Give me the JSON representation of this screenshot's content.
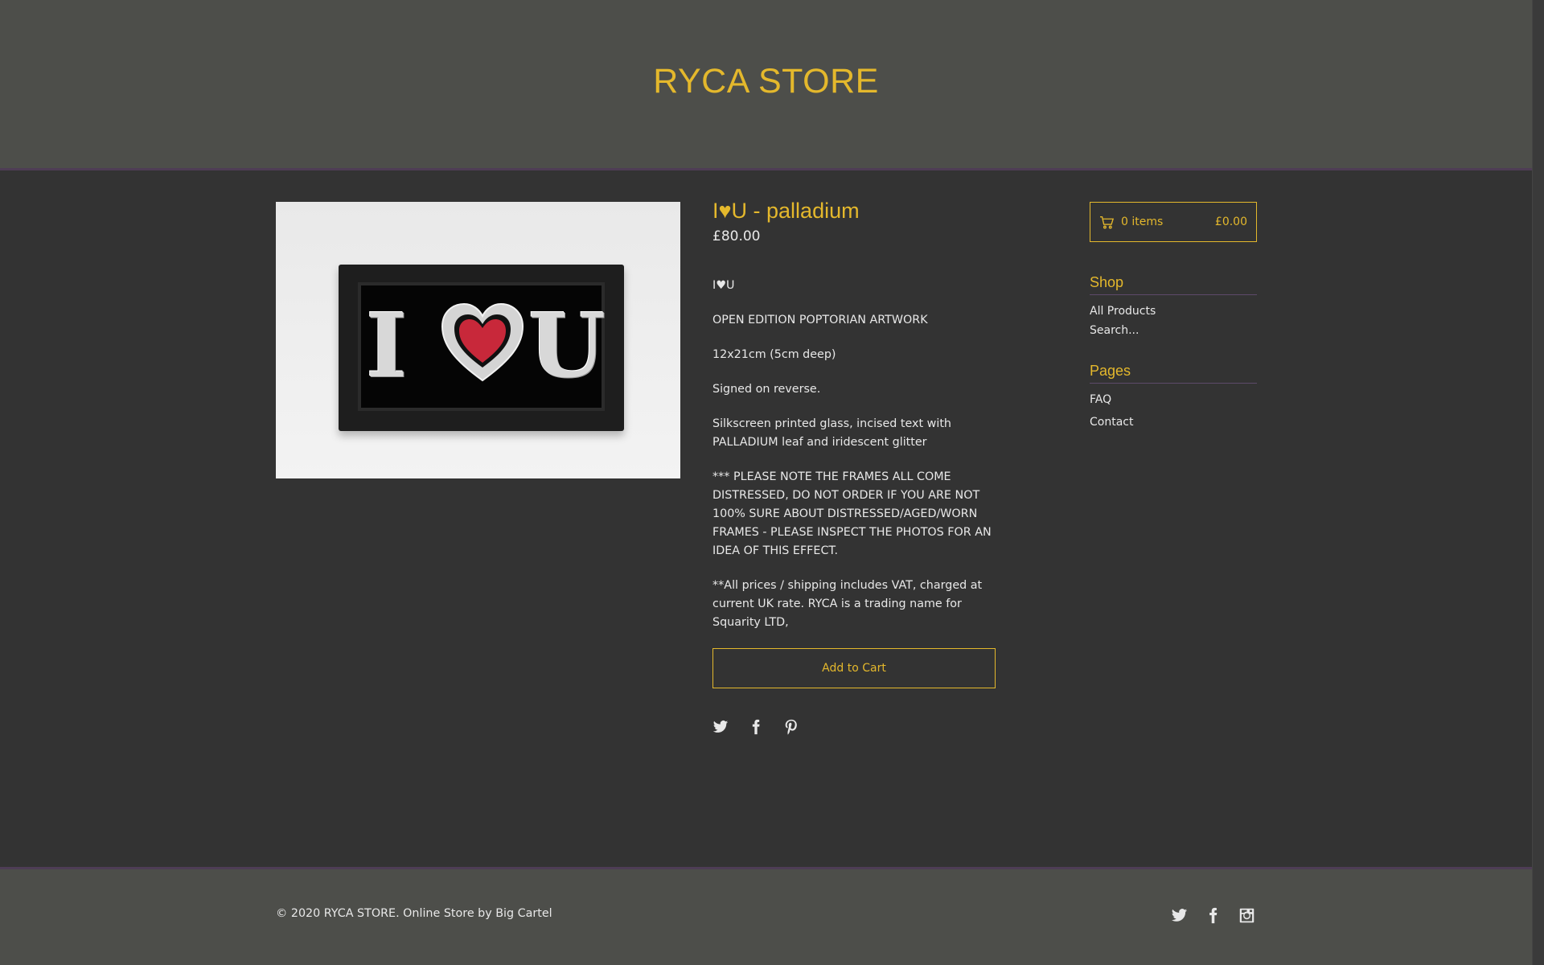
{
  "store": {
    "title": "RYCA STORE"
  },
  "product": {
    "name": "I♥U - palladium",
    "price": "£80.00",
    "description": [
      "I♥U",
      "OPEN EDITION POPTORIAN ARTWORK",
      "12x21cm (5cm deep)",
      "Signed on reverse.",
      "Silkscreen printed glass, incised text with PALLADIUM leaf and iridescent glitter",
      "*** PLEASE NOTE THE FRAMES ALL COME DISTRESSED, DO NOT ORDER IF YOU ARE NOT 100% SURE ABOUT DISTRESSED/AGED/WORN FRAMES - PLEASE INSPECT THE PHOTOS FOR AN IDEA OF THIS EFFECT.",
      "**All prices / shipping includes VAT, charged at current UK rate. RYCA is a trading name for Squarity LTD,"
    ],
    "add_to_cart_label": "Add to Cart",
    "image_letters": {
      "left": "I",
      "right": "U"
    }
  },
  "share_icons": [
    "twitter-icon",
    "facebook-icon",
    "pinterest-icon"
  ],
  "cart": {
    "items": "0 items",
    "total": "£0.00"
  },
  "sidebar": {
    "shop_heading": "Shop",
    "shop_links": [
      "All Products",
      "Search..."
    ],
    "pages_heading": "Pages",
    "pages_links": [
      "FAQ",
      "Contact"
    ]
  },
  "footer": {
    "copyright": "© 2020 RYCA STORE. Online Store by Big Cartel",
    "social_icons": [
      "twitter-icon",
      "facebook-icon",
      "instagram-icon"
    ]
  },
  "colors": {
    "accent": "#e4b82c",
    "header_bg": "#4d4e4a",
    "body_bg": "#333333",
    "divider": "#4e3d55"
  }
}
